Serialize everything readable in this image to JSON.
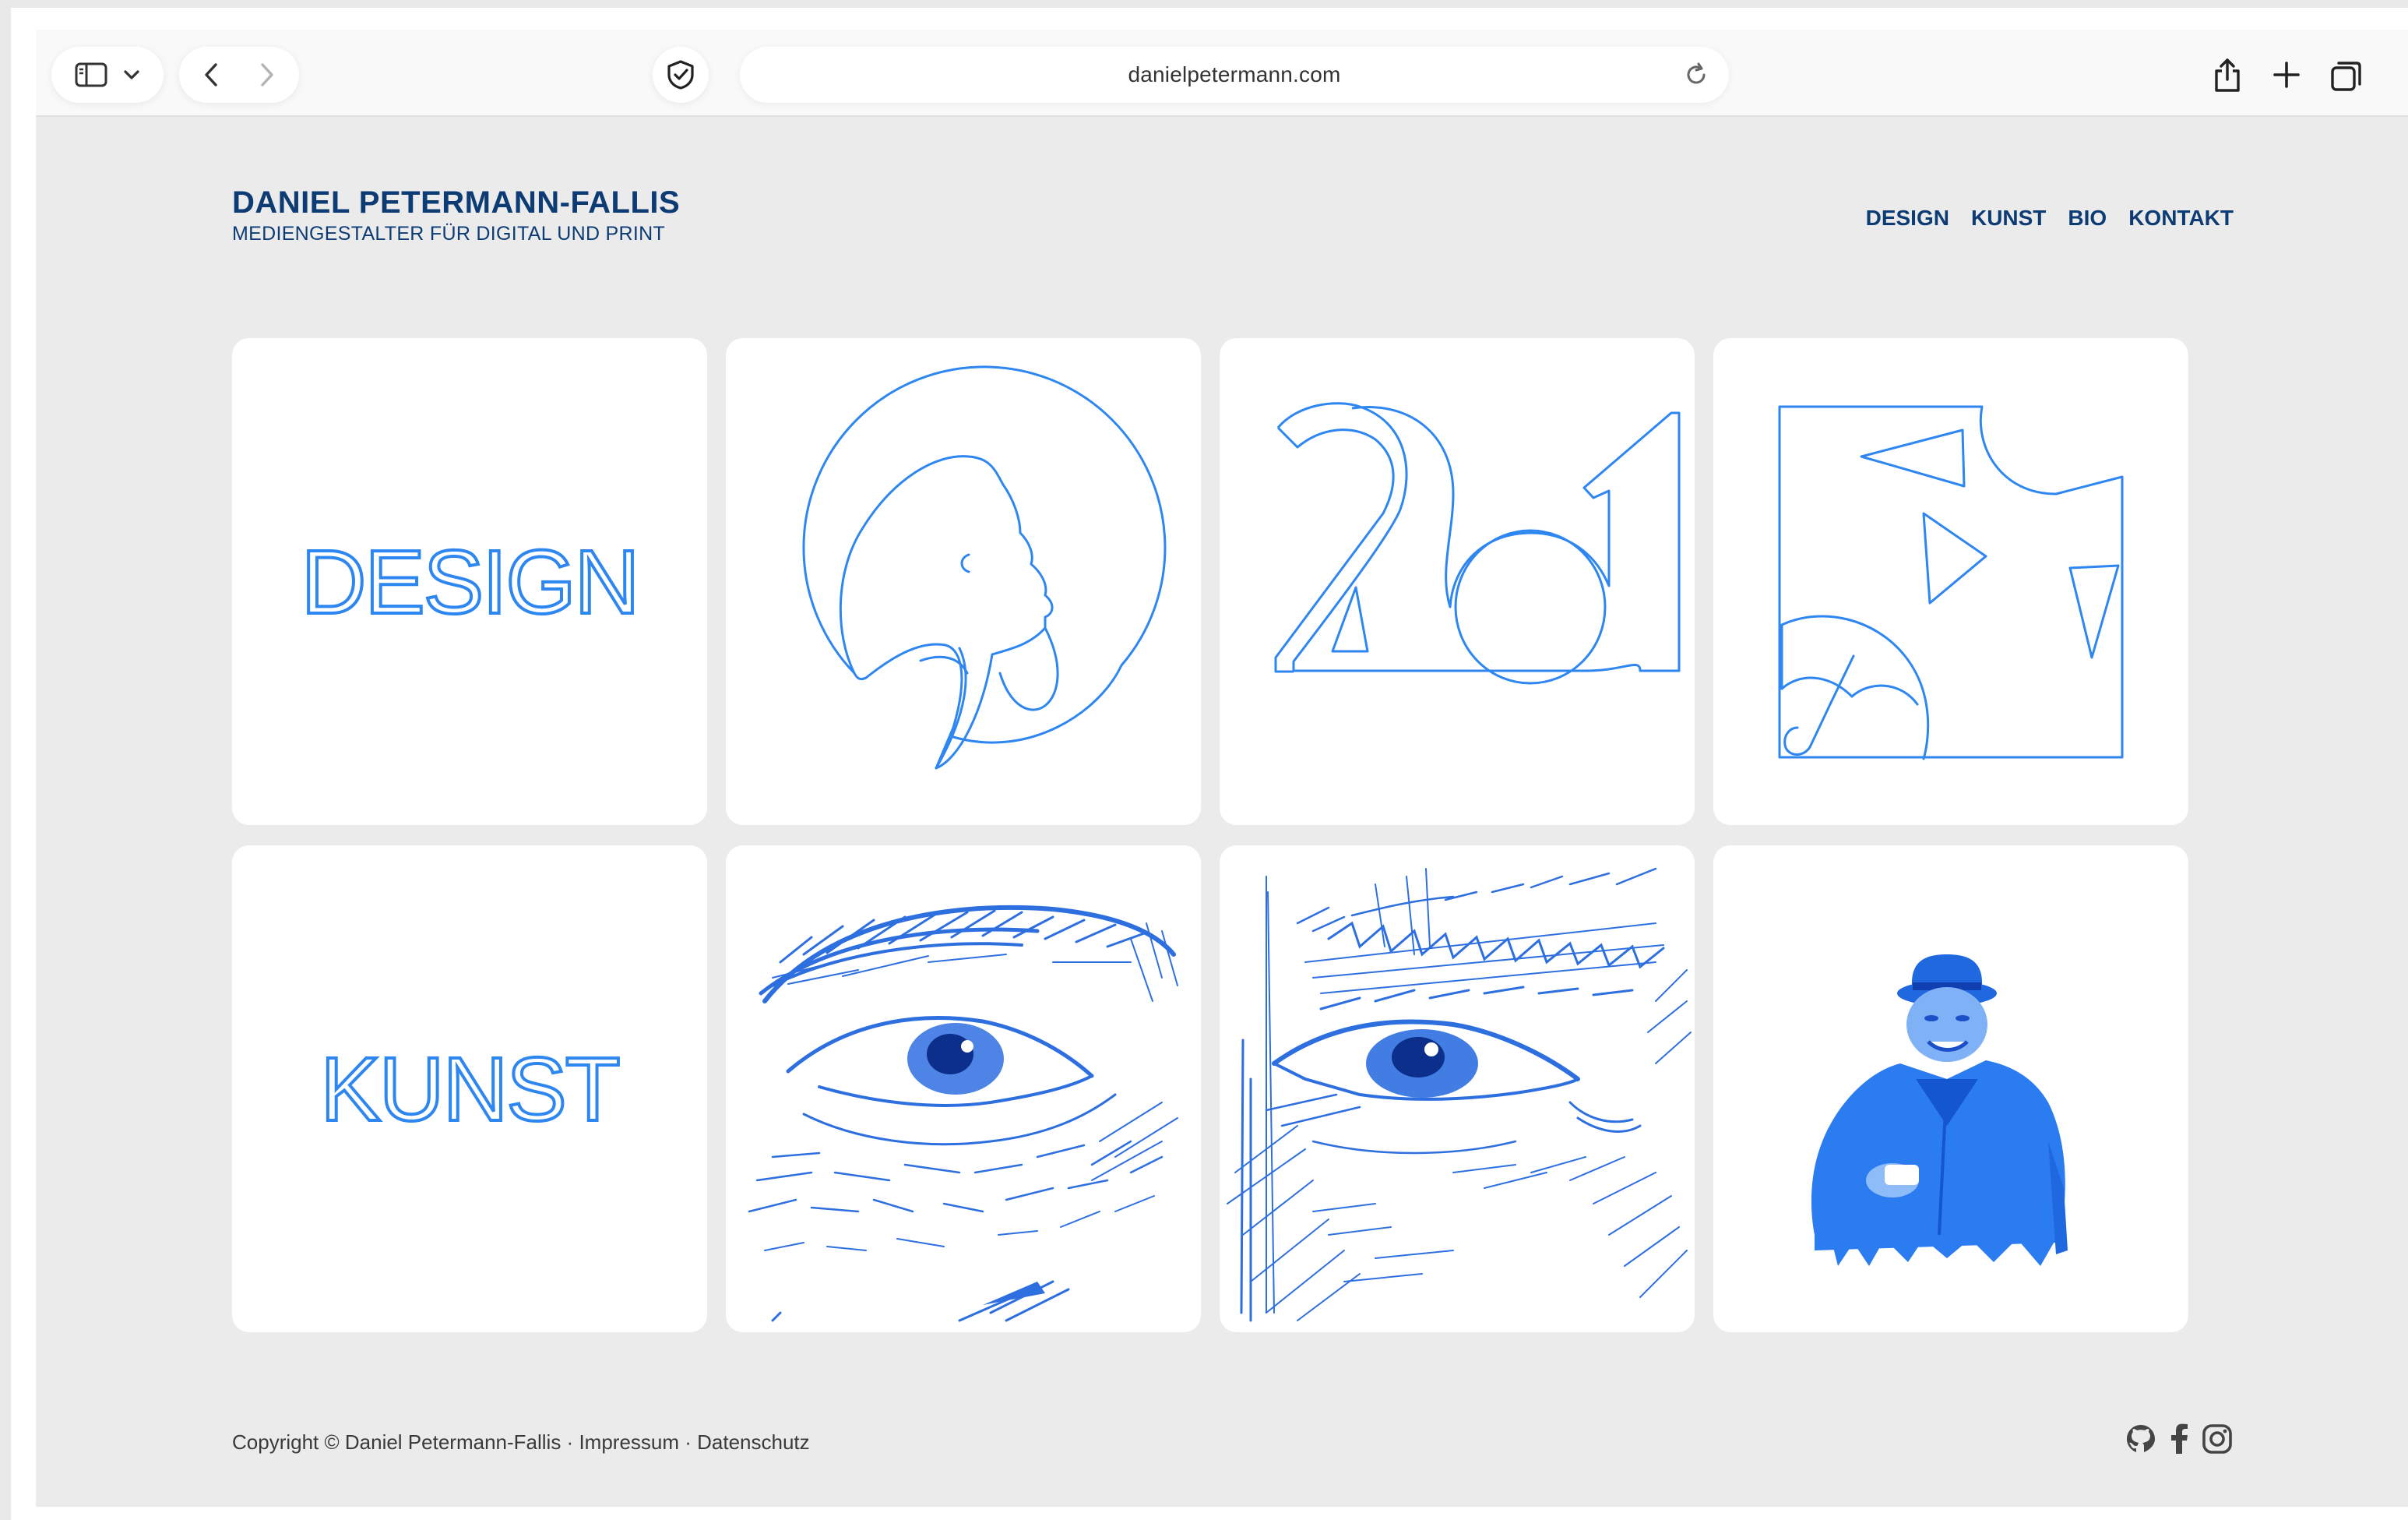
{
  "browser": {
    "url": "danielpetermann.com"
  },
  "site": {
    "title": "DANIEL PETERMANN-FALLIS",
    "subtitle": "MEDIENGESTALTER FÜR DIGITAL UND PRINT"
  },
  "nav": {
    "items": [
      "DESIGN",
      "KUNST",
      "BIO",
      "KONTAKT"
    ]
  },
  "tiles": {
    "design_label": "DESIGN",
    "kunst_label": "KUNST",
    "logo_2ol_text": "2ol"
  },
  "footer": {
    "copyright": "Copyright © Daniel Petermann-Fallis",
    "sep1": " · ",
    "impressum": "Impressum",
    "sep2": " · ",
    "datenschutz": "Datenschutz"
  },
  "colors": {
    "accent": "#2e86f0",
    "brand": "#0d3c74",
    "background": "#ebebeb"
  },
  "icons": [
    "sidebar-icon",
    "chevron-down-icon",
    "back-icon",
    "forward-icon",
    "shield-icon",
    "reload-icon",
    "share-icon",
    "plus-icon",
    "tabs-icon",
    "github-icon",
    "facebook-icon",
    "instagram-icon"
  ]
}
